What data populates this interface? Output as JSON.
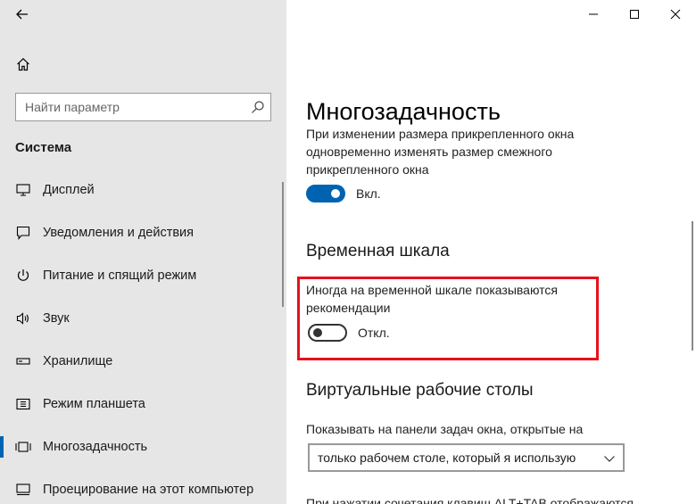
{
  "sidebar": {
    "search": {
      "placeholder": "Найти параметр"
    },
    "section_title": "Система",
    "items": [
      {
        "label": "Дисплей",
        "icon": "display-icon"
      },
      {
        "label": "Уведомления и действия",
        "icon": "notifications-icon"
      },
      {
        "label": "Питание и спящий режим",
        "icon": "power-icon"
      },
      {
        "label": "Звук",
        "icon": "sound-icon"
      },
      {
        "label": "Хранилище",
        "icon": "storage-icon"
      },
      {
        "label": "Режим планшета",
        "icon": "tablet-mode-icon"
      },
      {
        "label": "Многозадачность",
        "icon": "multitasking-icon",
        "selected": true
      },
      {
        "label": "Проецирование на этот компьютер",
        "icon": "projecting-icon"
      }
    ]
  },
  "main": {
    "title": "Многозадачность",
    "snap": {
      "text_partial": "При изменении размера прикрепленного окна одновременно изменять размер смежного прикрепленного окна",
      "toggle_label": "Вкл.",
      "toggle_on": true
    },
    "timeline": {
      "heading": "Временная шкала",
      "description": "Иногда на временной шкале показываются рекомендации",
      "toggle_label": "Откл.",
      "toggle_on": false
    },
    "virtual_desktops": {
      "heading": "Виртуальные рабочие столы",
      "taskbar_label": "Показывать на панели задач окна, открытые на",
      "dropdown_value": "только рабочем столе, который я использую",
      "alt_tab_partial": "При нажатии сочетания клавиш ALT+TAB отображаются"
    }
  },
  "colors": {
    "accent": "#0063b1",
    "highlight": "#e8101d",
    "sidebar_bg": "#e6e6e6"
  }
}
